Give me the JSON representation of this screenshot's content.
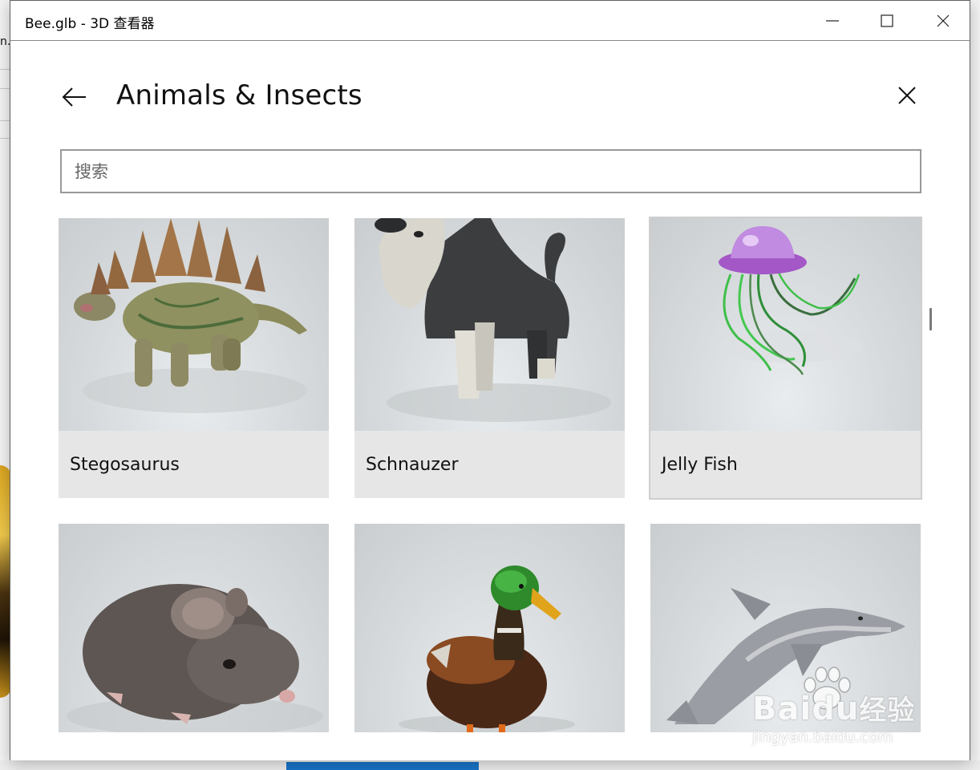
{
  "window": {
    "title": "Bee.glb - 3D 查看器"
  },
  "backdrop": {
    "partial_text": "n."
  },
  "panel": {
    "title": "Animals & Insects",
    "search": {
      "placeholder": "搜索",
      "value": ""
    }
  },
  "models": [
    {
      "label": "Stegosaurus",
      "icon": "stegosaurus-thumbnail"
    },
    {
      "label": "Schnauzer",
      "icon": "schnauzer-thumbnail"
    },
    {
      "label": "Jelly Fish",
      "icon": "jellyfish-thumbnail"
    },
    {
      "label": "",
      "icon": "mouse-thumbnail"
    },
    {
      "label": "",
      "icon": "duck-thumbnail"
    },
    {
      "label": "",
      "icon": "dolphin-thumbnail"
    }
  ],
  "watermark": {
    "brand_latin": "Bai",
    "brand_latin_2": "du",
    "brand_cn": "经验",
    "url": "jingyan.baidu.com"
  },
  "colors": {
    "window_bg": "#ffffff",
    "card_bg": "#e6e6e6",
    "border": "#999999",
    "text": "#111111"
  }
}
